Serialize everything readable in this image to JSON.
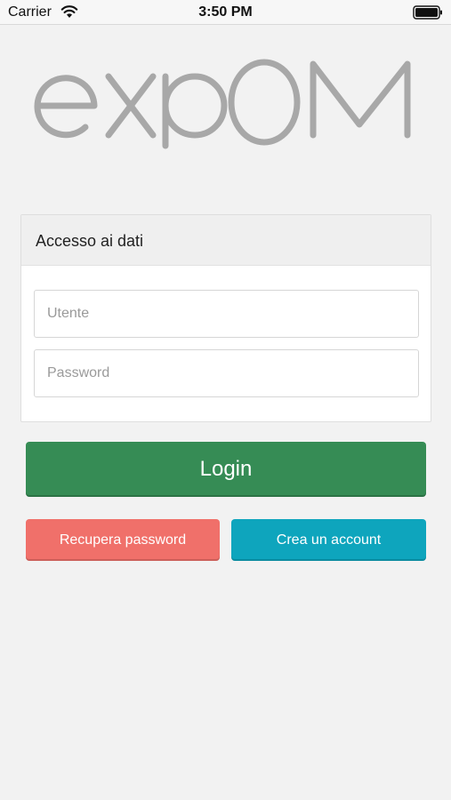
{
  "status_bar": {
    "carrier": "Carrier",
    "time": "3:50 PM",
    "icons": [
      "wifi-icon",
      "battery-icon"
    ]
  },
  "logo": {
    "text": "expOM",
    "color": "#a8a8a8"
  },
  "login_panel": {
    "title": "Accesso ai dati",
    "username_placeholder": "Utente",
    "username_value": "",
    "password_placeholder": "Password",
    "password_value": ""
  },
  "buttons": {
    "login_label": "Login",
    "recover_label": "Recupera password",
    "create_label": "Crea un account"
  },
  "colors": {
    "login": "#368c55",
    "recover": "#f0706a",
    "create": "#0ea5bd",
    "background": "#f2f2f2"
  }
}
